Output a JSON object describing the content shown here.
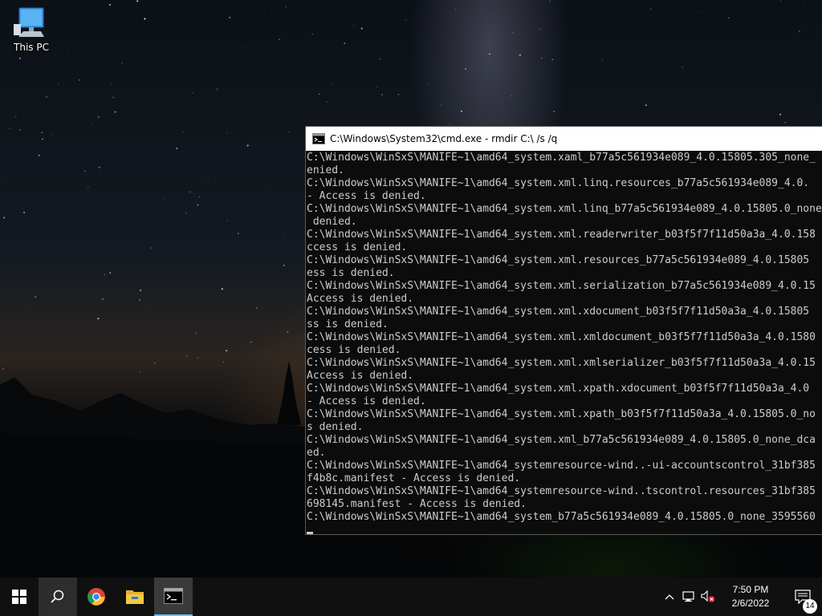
{
  "desktop": {
    "icons": [
      {
        "label": "This PC",
        "icon": "computer-icon"
      }
    ]
  },
  "cmd_window": {
    "title": "C:\\Windows\\System32\\cmd.exe - rmdir  C:\\ /s /q",
    "lines": [
      "C:\\Windows\\WinSxS\\MANIFE~1\\amd64_system.xaml_b77a5c561934e089_4.0.15805.305_none_",
      "enied.",
      "C:\\Windows\\WinSxS\\MANIFE~1\\amd64_system.xml.linq.resources_b77a5c561934e089_4.0.",
      "- Access is denied.",
      "C:\\Windows\\WinSxS\\MANIFE~1\\amd64_system.xml.linq_b77a5c561934e089_4.0.15805.0_none",
      " denied.",
      "C:\\Windows\\WinSxS\\MANIFE~1\\amd64_system.xml.readerwriter_b03f5f7f11d50a3a_4.0.158",
      "ccess is denied.",
      "C:\\Windows\\WinSxS\\MANIFE~1\\amd64_system.xml.resources_b77a5c561934e089_4.0.15805",
      "ess is denied.",
      "C:\\Windows\\WinSxS\\MANIFE~1\\amd64_system.xml.serialization_b77a5c561934e089_4.0.15",
      "Access is denied.",
      "C:\\Windows\\WinSxS\\MANIFE~1\\amd64_system.xml.xdocument_b03f5f7f11d50a3a_4.0.15805",
      "ss is denied.",
      "C:\\Windows\\WinSxS\\MANIFE~1\\amd64_system.xml.xmldocument_b03f5f7f11d50a3a_4.0.1580",
      "cess is denied.",
      "C:\\Windows\\WinSxS\\MANIFE~1\\amd64_system.xml.xmlserializer_b03f5f7f11d50a3a_4.0.15",
      "Access is denied.",
      "C:\\Windows\\WinSxS\\MANIFE~1\\amd64_system.xml.xpath.xdocument_b03f5f7f11d50a3a_4.0",
      "- Access is denied.",
      "C:\\Windows\\WinSxS\\MANIFE~1\\amd64_system.xml.xpath_b03f5f7f11d50a3a_4.0.15805.0_no",
      "s denied.",
      "C:\\Windows\\WinSxS\\MANIFE~1\\amd64_system.xml_b77a5c561934e089_4.0.15805.0_none_dca",
      "ed.",
      "C:\\Windows\\WinSxS\\MANIFE~1\\amd64_systemresource-wind..-ui-accountscontrol_31bf385",
      "f4b8c.manifest - Access is denied.",
      "C:\\Windows\\WinSxS\\MANIFE~1\\amd64_systemresource-wind..tscontrol.resources_31bf385",
      "698145.manifest - Access is denied.",
      "C:\\Windows\\WinSxS\\MANIFE~1\\amd64_system_b77a5c561934e089_4.0.15805.0_none_3595560"
    ]
  },
  "taskbar": {
    "buttons": [
      {
        "name": "start-button",
        "icon": "windows-logo-icon"
      },
      {
        "name": "search-button",
        "icon": "search-icon"
      },
      {
        "name": "chrome-button",
        "icon": "chrome-icon"
      },
      {
        "name": "file-explorer-button",
        "icon": "folder-icon"
      },
      {
        "name": "cmd-taskbar-button",
        "icon": "cmd-icon"
      }
    ],
    "tray": {
      "icons": [
        "chevron-up-icon",
        "network-icon",
        "volume-muted-icon"
      ],
      "time": "7:50 PM",
      "date": "2/6/2022",
      "notification_count": "14"
    }
  },
  "colors": {
    "console_bg": "#0c0c0c",
    "console_text": "#cccccc",
    "taskbar_bg": "#101010",
    "accent": "#76b9ed"
  }
}
